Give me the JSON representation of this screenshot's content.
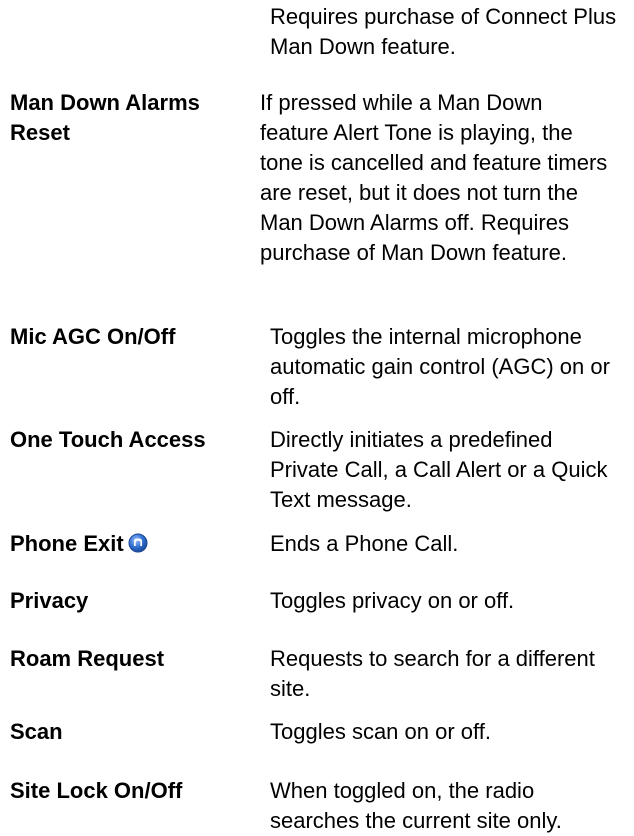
{
  "rows": [
    {
      "term": "",
      "desc": "Requires purchase of Connect Plus Man Down feature."
    },
    {
      "term": "Man Down Alarms Reset",
      "desc": "If pressed while a Man Down feature Alert Tone is playing, the tone is cancelled and feature timers are reset, but it does not turn the Man Down Alarms off. Requires purchase of Man Down feature."
    },
    {
      "term": "Mic AGC On/Off",
      "desc": "Toggles the internal microphone automatic gain control (AGC) on or off."
    },
    {
      "term": "One Touch Access",
      "desc": "Directly initiates a predefined Private Call, a Call Alert or a Quick Text message."
    },
    {
      "term": "Phone Exit",
      "desc": "Ends a Phone Call."
    },
    {
      "term": "Privacy",
      "desc": "Toggles privacy on or off."
    },
    {
      "term": "Roam Request",
      "desc": "Requests to search for a different site."
    },
    {
      "term": "Scan",
      "desc": "Toggles scan on or off."
    },
    {
      "term": "Site Lock On/Off",
      "desc": "When toggled on, the radio searches the current site only."
    }
  ],
  "icons": {
    "phone_exit_icon": "phone-icon"
  },
  "colors": {
    "icon_blue": "#2f6fd0",
    "text": "#000000",
    "background": "#ffffff"
  }
}
